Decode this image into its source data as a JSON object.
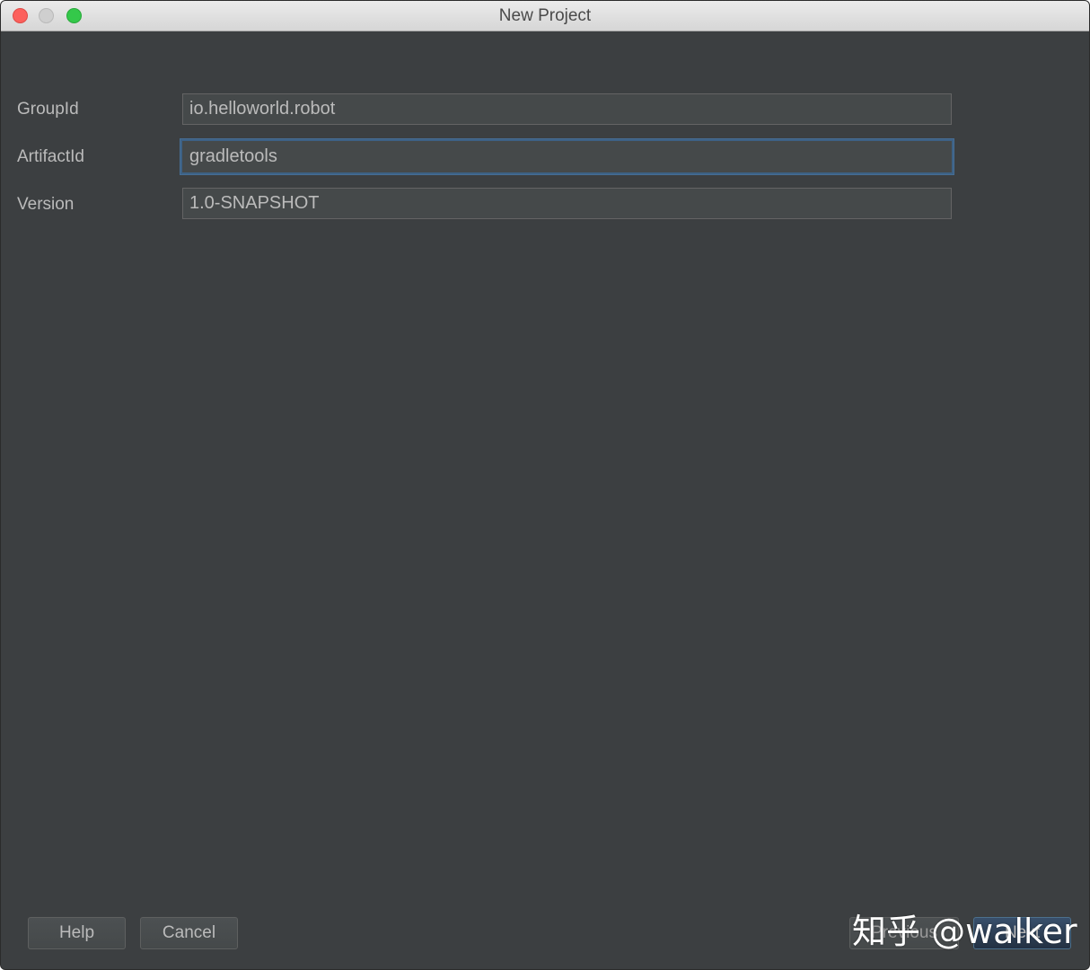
{
  "window": {
    "title": "New Project"
  },
  "form": {
    "group_id": {
      "label": "GroupId",
      "value": "io.helloworld.robot"
    },
    "artifact_id": {
      "label": "ArtifactId",
      "value": "gradletools"
    },
    "version": {
      "label": "Version",
      "value": "1.0-SNAPSHOT"
    }
  },
  "buttons": {
    "help": "Help",
    "cancel": "Cancel",
    "previous": "Previous",
    "next": "Next"
  },
  "watermark": "知乎 @walker",
  "colors": {
    "background": "#3c3f41",
    "field_background": "#45494a",
    "focus_border": "#3d6185",
    "text": "#bbbbbb"
  }
}
